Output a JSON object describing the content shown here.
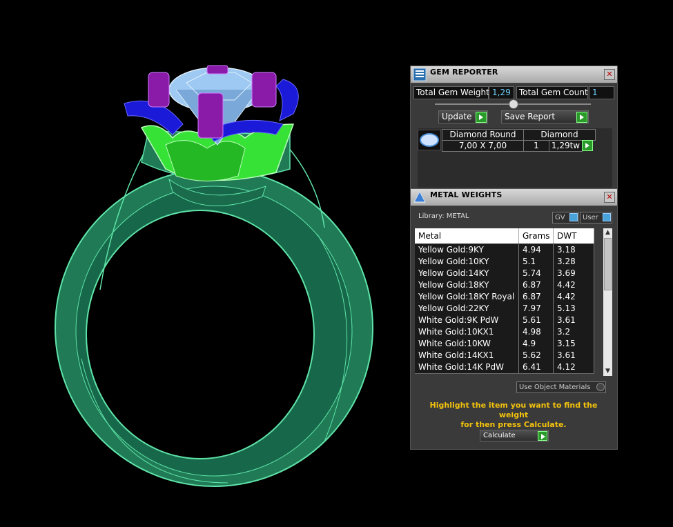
{
  "gem_reporter": {
    "title": "GEM REPORTER",
    "total_gem_weight_label": "Total Gem Weight",
    "total_gem_weight_value": "1,29",
    "total_gem_count_label": "Total Gem Count",
    "total_gem_count_value": "1",
    "update_label": "Update",
    "save_report_label": "Save Report",
    "gem": {
      "name": "Diamond Round",
      "size": "7,00 X 7,00",
      "type": "Diamond",
      "count": "1",
      "weight": "1,29tw"
    }
  },
  "metal_weights": {
    "title": "METAL WEIGHTS",
    "library_label": "Library: METAL",
    "gv_label": "GV",
    "user_label": "User",
    "columns": [
      "Metal",
      "Grams",
      "DWT"
    ],
    "rows": [
      [
        "Yellow Gold:9KY",
        "4.94",
        "3.18"
      ],
      [
        "Yellow Gold:10KY",
        "5.1",
        "3.28"
      ],
      [
        "Yellow Gold:14KY",
        "5.74",
        "3.69"
      ],
      [
        "Yellow Gold:18KY",
        "6.87",
        "4.42"
      ],
      [
        "Yellow Gold:18KY Royal",
        "6.87",
        "4.42"
      ],
      [
        "Yellow Gold:22KY",
        "7.97",
        "5.13"
      ],
      [
        "White Gold:9K PdW",
        "5.61",
        "3.61"
      ],
      [
        "White Gold:10KX1",
        "4.98",
        "3.2"
      ],
      [
        "White Gold:10KW",
        "4.9",
        "3.15"
      ],
      [
        "White Gold:14KX1",
        "5.62",
        "3.61"
      ],
      [
        "White Gold:14K PdW",
        "6.41",
        "4.12"
      ]
    ],
    "use_object_materials_label": "Use Object Materials",
    "hint_line1": "Highlight the item you want to find the weight",
    "hint_line2": "for then press Calculate.",
    "calculate_label": "Calculate"
  },
  "colors": {
    "band": "#1f7a55",
    "band_edge": "#5fe3a8",
    "gallery": "#37e237",
    "prongs_blue": "#1a1ad8",
    "prongs_purple": "#8a1aa8",
    "gem": "#9ec9f2",
    "hint": "#f2c20d",
    "value": "#6fd3ff"
  }
}
